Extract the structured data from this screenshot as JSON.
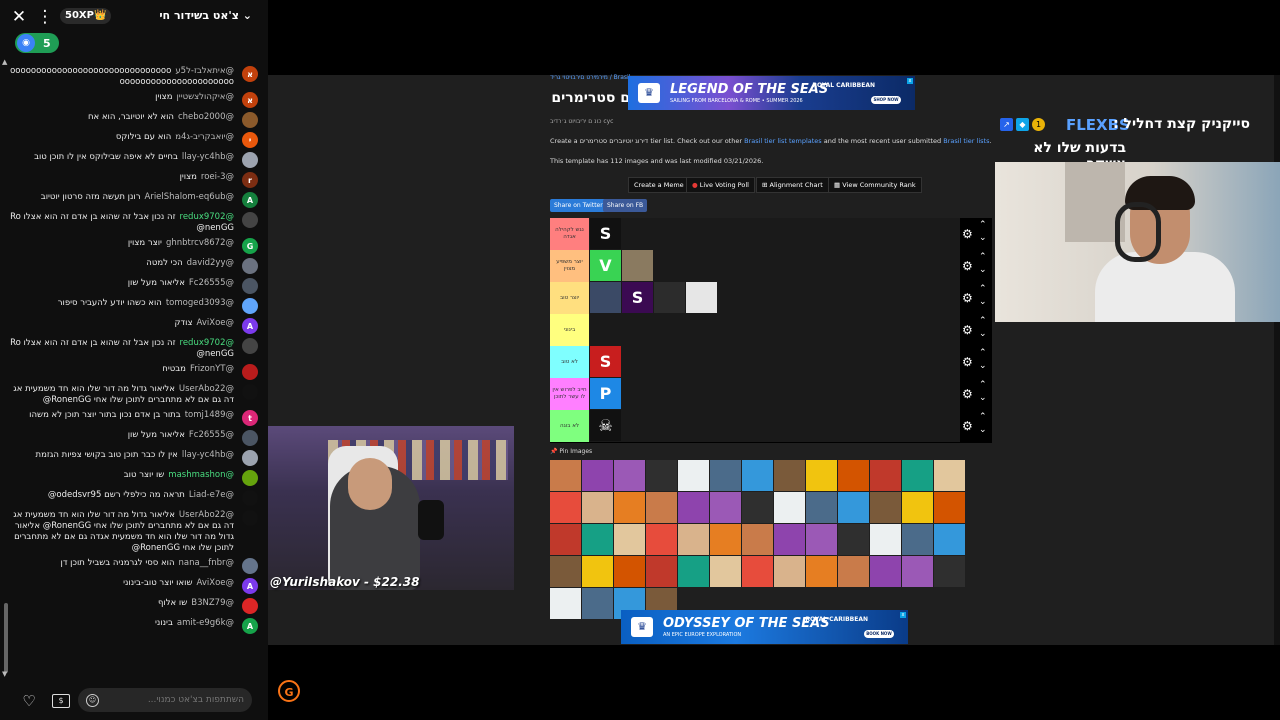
{
  "chat": {
    "title": "צ'אט בשידור חי",
    "xp_badge": "50XP👑",
    "viewer_count": "5",
    "input_placeholder": "השתתפות בצ'אט כמנוי...",
    "messages": [
      {
        "author": "@איתאלבז-ל5ע",
        "text": "ooooooooooooooooooooooooooooooooooooooooooooooooooooo",
        "avatar": "א",
        "color": "#c2410c"
      },
      {
        "author": "@איקהולצשטיין",
        "text": "מצוין",
        "avatar": "א",
        "color": "#c2410c"
      },
      {
        "author": "@chebo2000",
        "text": "הוא לא יוטיובר, הוא אח",
        "avatar": "",
        "color": "#8b5a2b"
      },
      {
        "author": "@יואבקריב-ג4מ",
        "text": "הוא עם בילוקס",
        "avatar": "י",
        "color": "#ea580c"
      },
      {
        "author": "@llay-yc4hb",
        "text": "בחיים לא איפה שבילוקס אין לו תוכן טוב",
        "avatar": "",
        "color": "#9ca3af"
      },
      {
        "author": "@roei-3",
        "text": "מצוין",
        "avatar": "r",
        "color": "#7c2d12"
      },
      {
        "author": "@ArielShalom-eq6ub",
        "text": "רונן תעשה מזה סרטון יוטיוב",
        "avatar": "A",
        "color": "#15803d"
      },
      {
        "author": "@redux9702",
        "text": "זה נכון אבל זה שהוא בן אדם זה הוא אצלו RonenGG@",
        "avatar": "",
        "color": "#444",
        "green": true
      },
      {
        "author": "@ghnbtrcv8672",
        "text": "יוצר מצוין",
        "avatar": "G",
        "color": "#16a34a"
      },
      {
        "author": "@david2yy",
        "text": "הכי למטה",
        "avatar": "",
        "color": "#6b7280"
      },
      {
        "author": "@Fc26555",
        "text": "אליאור מעל שון",
        "avatar": "",
        "color": "#4b5563"
      },
      {
        "author": "@tomoged3093",
        "text": "הוא כשהו יודע להעביר סיפור",
        "avatar": "",
        "color": "#60a5fa"
      },
      {
        "author": "@AviXoe",
        "text": "צודק",
        "avatar": "A",
        "color": "#7c3aed"
      },
      {
        "author": "@redux9702",
        "text": "זה נכון אבל זה שהוא בן אדם זה הוא אצלו RonenGG@",
        "avatar": "",
        "color": "#444",
        "green": true
      },
      {
        "author": "@FrizonYT",
        "text": "מבטיח",
        "avatar": "",
        "color": "#b91c1c"
      },
      {
        "author": "@UserAbo22",
        "text": "אליאור גדול מה דור שלו הוא חד משמעית אגדה גם אם לא מתחברים לתוכן שלו אחי RonenGG@",
        "avatar": "",
        "color": "#111"
      },
      {
        "author": "@tomj1489",
        "text": "בתור בן אדם נכון בתור יוצר תוכן לא משהו",
        "avatar": "t",
        "color": "#db2777"
      },
      {
        "author": "@Fc26555",
        "text": "אליאור מעל שון",
        "avatar": "",
        "color": "#4b5563"
      },
      {
        "author": "@llay-yc4hb",
        "text": "אין לו כבר תוכן טוב בקושי צפיות הגזמת",
        "avatar": "",
        "color": "#9ca3af"
      },
      {
        "author": "@mashmashon",
        "text": "שו יוצר טוב",
        "avatar": "",
        "color": "#65a30d",
        "green": true
      },
      {
        "author": "@Liad-e7e",
        "text": "תראה מה כילפלי רשם odedsvr95@",
        "avatar": "",
        "color": "#111"
      },
      {
        "author": "@UserAbo22",
        "text": "אליאור גדול מה דור שלו הוא חד משמעית אגדה גם אם לא מתחברים לתוכן שלו אחי RonenGG@ אליאור גדול מה דור שלו הוא חד משמעית אגדה גם אם לא מתחברים לתוכן שלו אחי RonenGG@",
        "avatar": "",
        "color": "#111"
      },
      {
        "author": "@nana__fnbr",
        "text": "הוא ססי לגרמניה בשביל תוכן דן",
        "avatar": "",
        "color": "#64748b"
      },
      {
        "author": "@AviXoe",
        "text": "שואו יוצר טוב-בינוני",
        "avatar": "A",
        "color": "#7c3aed"
      },
      {
        "author": "@B3NZ79",
        "text": "שו אלוף",
        "avatar": "",
        "color": "#dc2626"
      },
      {
        "author": "@amit-e9g6k",
        "text": "בינוני",
        "avatar": "A",
        "color": "#16a34a"
      }
    ]
  },
  "stream1": {
    "donation_label": "@YuriIshakov - $22.38"
  },
  "page": {
    "breadcrumb": "Brasil / מירמירט םירבויטוי גריד",
    "title": "ם סטרימרים",
    "small_note": "כונ ם יריבויוט ג׳רדיב cyc",
    "desc_before": "Create a דירוג יוטיוברים סטרימרים tier list. Check out our other ",
    "desc_link1": "Brasil tier list templates",
    "desc_middle": " and the most recent user submitted ",
    "desc_link2": "Brasil tier lists",
    "desc_end": ".",
    "modified": "This template has 112 images and was last modified 03/21/2026.",
    "buttons": {
      "create_meme": "Create a Meme",
      "live_voting": "Live Voting Poll",
      "alignment": "Alignment Chart",
      "community": "View Community Rank"
    },
    "share_twitter": "Share on Twitter",
    "share_fb": "Share on FB",
    "pin_label": "📌 Pin Images",
    "tiers": [
      {
        "label": "נגש לקהילה אגדה",
        "color": "#ff7f7f",
        "items": [
          {
            "glyph": "S",
            "bg": "#111"
          }
        ]
      },
      {
        "label": "יוצר משפיע מצוין",
        "color": "#ffbf7f",
        "items": [
          {
            "glyph": "V",
            "bg": "#39d353"
          },
          {
            "glyph": "",
            "bg": "#8a7a60"
          }
        ]
      },
      {
        "label": "יוצר טוב",
        "color": "#ffdf7f",
        "items": [
          {
            "glyph": "",
            "bg": "#3b4a66"
          },
          {
            "glyph": "S",
            "bg": "#3b0a52"
          },
          {
            "glyph": "",
            "bg": "#2c2c2c"
          },
          {
            "glyph": "",
            "bg": "#e6e6e6"
          }
        ]
      },
      {
        "label": "בינוני",
        "color": "#ffff7f",
        "items": []
      },
      {
        "label": "לא טוב",
        "color": "#bfff7f",
        "items": [
          {
            "glyph": "S",
            "bg": "#c81e1e"
          }
        ]
      },
      {
        "label": "חייב לפרוש אין לו עשר לתוכן",
        "color": "#7fffff",
        "items": [
          {
            "glyph": "P",
            "bg": "#1e88e5"
          }
        ]
      },
      {
        "label": "לא בוגה",
        "color": "#7fbfff",
        "items": [
          {
            "glyph": "☠",
            "bg": "#111"
          }
        ]
      }
    ],
    "tier_label_colors_row": [
      "#ff7f7f",
      "#ffbf7f",
      "#ffdf7f",
      "#ffff7f",
      "#7fffff",
      "#ff7fff",
      "#7fff7f"
    ]
  },
  "ads": {
    "top": {
      "title": "LEGEND OF THE SEAS",
      "sub": "SAILING FROM BARCELONA & ROME • SUMMER 2026",
      "brand": "ROYAL CARIBBEAN",
      "cta": "SHOP NOW"
    },
    "bottom": {
      "title": "ODYSSEY OF THE SEAS",
      "sub": "AN EPIC EUROPE EXPLORATION",
      "brand": "ROYAL CARIBBEAN",
      "cta": "BOOK NOW"
    }
  },
  "stream2": {
    "title": "סייקניק קצת דחליל :",
    "user": "FLEXBS",
    "subtitle": "בדעות שלו לא אשקר"
  },
  "colors": {
    "chat_bg": "#0f0f0f",
    "page_bg": "#1f1f1f",
    "viewer_green": "#1f9d55",
    "link_blue": "#5aa1ff"
  }
}
